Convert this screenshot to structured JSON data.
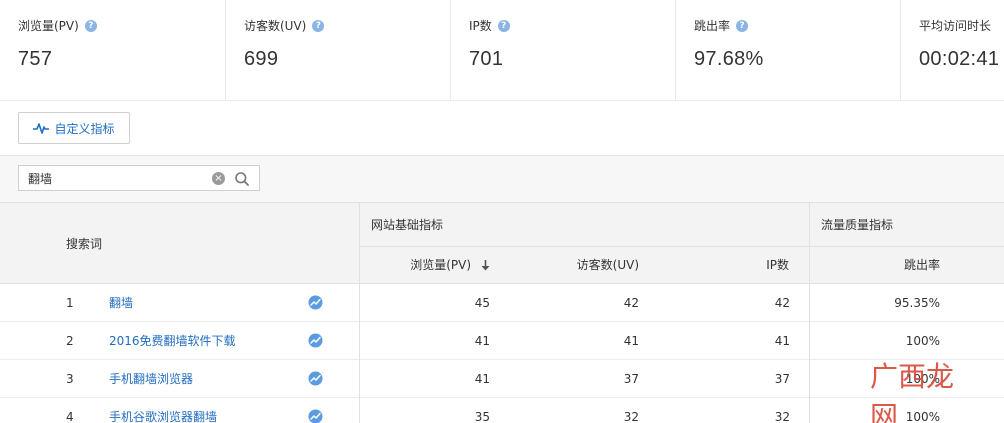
{
  "metrics": [
    {
      "label": "浏览量(PV)",
      "value": "757",
      "help": true
    },
    {
      "label": "访客数(UV)",
      "value": "699",
      "help": true
    },
    {
      "label": "IP数",
      "value": "701",
      "help": true
    },
    {
      "label": "跳出率",
      "value": "97.68%",
      "help": true
    },
    {
      "label": "平均访问时长",
      "value": "00:02:41",
      "help": false
    }
  ],
  "help_glyph": "?",
  "toolbar": {
    "custom_metric_label": "自定义指标"
  },
  "search": {
    "value": "翻墙",
    "clear_glyph": "×"
  },
  "table": {
    "keyword_header": "搜索词",
    "group_site": "网站基础指标",
    "group_quality": "流量质量指标",
    "columns": {
      "pv": "浏览量(PV)",
      "uv": "访客数(UV)",
      "ip": "IP数",
      "bounce": "跳出率"
    },
    "rows": [
      {
        "idx": "1",
        "keyword": "翻墙",
        "pv": "45",
        "uv": "42",
        "ip": "42",
        "bounce": "95.35%"
      },
      {
        "idx": "2",
        "keyword": "2016免费翻墙软件下载",
        "pv": "41",
        "uv": "41",
        "ip": "41",
        "bounce": "100%"
      },
      {
        "idx": "3",
        "keyword": "手机翻墙浏览器",
        "pv": "41",
        "uv": "37",
        "ip": "37",
        "bounce": "100%"
      },
      {
        "idx": "4",
        "keyword": "手机谷歌浏览器翻墙",
        "pv": "35",
        "uv": "32",
        "ip": "32",
        "bounce": "100%"
      }
    ]
  },
  "watermark": "广西龙网",
  "colors": {
    "link": "#1f6dc2",
    "help": "#8ab4e6",
    "trend": "#5b9be0",
    "watermark": "#d94a3a"
  }
}
